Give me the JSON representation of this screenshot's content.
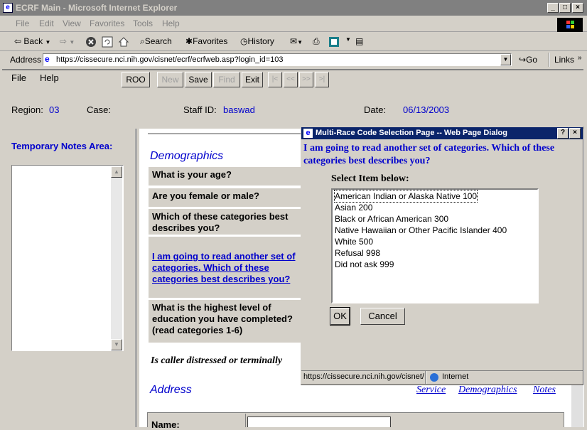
{
  "window": {
    "title": "ECRF Main - Microsoft Internet Explorer",
    "min": "_",
    "max": "□",
    "close": "×"
  },
  "menu": [
    "File",
    "Edit",
    "View",
    "Favorites",
    "Tools",
    "Help"
  ],
  "toolbar": {
    "back": "Back",
    "search": "Search",
    "favorites": "Favorites",
    "history": "History"
  },
  "address": {
    "label": "Address",
    "url": "https://cissecure.nci.nih.gov/cisnet/ecrf/ecrfweb.asp?login_id=103",
    "go": "Go",
    "links": "Links"
  },
  "app": {
    "menu_file": "File",
    "menu_help": "Help",
    "buttons": [
      "ROO",
      "New",
      "Save",
      "Find",
      "Exit",
      "|<",
      "<<",
      ">>",
      ">|"
    ],
    "region_label": "Region:",
    "region_value": "03",
    "case_label": "Case:",
    "staff_label": "Staff ID:",
    "staff_value": "baswad",
    "date_label": "Date:",
    "date_value": "06/13/2003"
  },
  "sidebar": {
    "title": "Temporary Notes Area:"
  },
  "content": {
    "section_demographics": "Demographics",
    "q_age": "What is your age?",
    "q_sex": "Are you female or male?",
    "q_categories": "Which of these categories best describes you?",
    "q_race_link": "I am going to read another set of categories. Which of these categories best describes you?",
    "q_education": "What is the highest level of education you have completed? (read categories 1-6)",
    "distress": "Is caller distressed or terminally",
    "section_address": "Address",
    "nav_service": "Service",
    "nav_demographics": "Demographics",
    "nav_notes": "Notes",
    "name_label": "Name:"
  },
  "dialog": {
    "title": "Multi-Race Code Selection Page -- Web Page Dialog",
    "help": "?",
    "close": "×",
    "question": "I am going to read another set of categories.  Which of these categories best describes you?",
    "select_label": "Select Item below:",
    "options": [
      "American Indian or Alaska Native  100",
      "Asian  200",
      "Black or African American  300",
      "Native Hawaiian or Other Pacific Islander  400",
      "White  500",
      "Refusal  998",
      "Did not ask  999"
    ],
    "ok": "OK",
    "cancel": "Cancel",
    "status_url": "https://cissecure.nci.nih.gov/cisnet/",
    "status_zone": "Internet"
  }
}
